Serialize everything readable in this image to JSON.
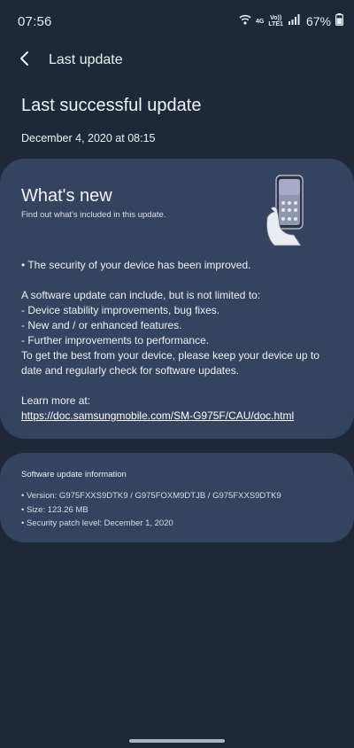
{
  "status_bar": {
    "time": "07:56",
    "net_top": "4G",
    "net_mid": "Vo)) ",
    "net_bottom": "LTE1",
    "battery": "67%"
  },
  "app_bar": {
    "title": "Last update"
  },
  "header": {
    "heading": "Last successful update",
    "date": "December 4, 2020 at 08:15"
  },
  "whats_new": {
    "title": "What's new",
    "subtitle": "Find out what's included in this update.",
    "line_security": "• The security of your device has been improved.",
    "line_intro": "A software update can include, but is not limited to:",
    "line_item1": " - Device stability improvements, bug fixes.",
    "line_item2": " - New and / or enhanced features.",
    "line_item3": " - Further improvements to performance.",
    "line_advice": "To get the best from your device, please keep your device up to date and regularly check for software updates.",
    "learn_more": "Learn more at:",
    "link": "https://doc.samsungmobile.com/SM-G975F/CAU/doc.html"
  },
  "info": {
    "title": "Software update information",
    "version": "• Version: G975FXXS9DTK9 / G975FOXM9DTJB / G975FXXS9DTK9",
    "size": "• Size: 123.26 MB",
    "patch": "• Security patch level: December 1, 2020"
  },
  "colors": {
    "background": "#1e2838",
    "card": "#34435e",
    "text": "#ffffff"
  },
  "icons": [
    "wifi-icon",
    "signal-icon",
    "battery-icon",
    "back-arrow-icon",
    "phone-illustration"
  ]
}
